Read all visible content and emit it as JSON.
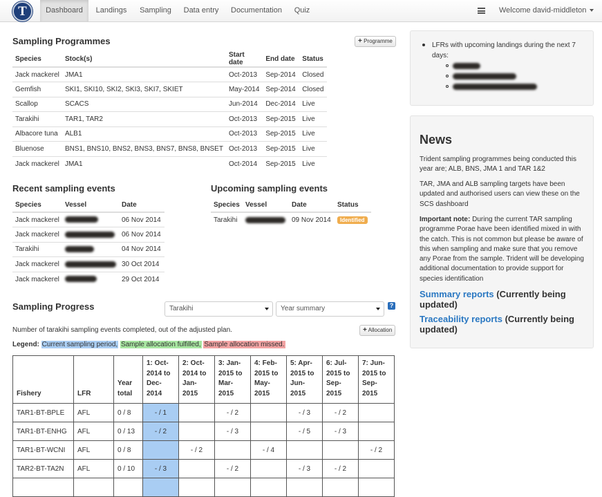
{
  "nav": {
    "logo_letter": "T",
    "items": [
      "Dashboard",
      "Landings",
      "Sampling",
      "Data entry",
      "Documentation",
      "Quiz"
    ],
    "welcome": "Welcome david-middleton"
  },
  "programmes": {
    "title": "Sampling Programmes",
    "button_label": "Programme",
    "headers": [
      "Species",
      "Stock(s)",
      "Start date",
      "End date",
      "Status"
    ],
    "rows": [
      [
        "Jack mackerel",
        "JMA1",
        "Oct-2013",
        "Sep-2014",
        "Closed"
      ],
      [
        "Gemfish",
        "SKI1, SKI10, SKI2, SKI3, SKI7, SKIET",
        "May-2014",
        "Sep-2014",
        "Closed"
      ],
      [
        "Scallop",
        "SCACS",
        "Jun-2014",
        "Dec-2014",
        "Live"
      ],
      [
        "Tarakihi",
        "TAR1, TAR2",
        "Oct-2013",
        "Sep-2015",
        "Live"
      ],
      [
        "Albacore tuna",
        "ALB1",
        "Oct-2013",
        "Sep-2015",
        "Live"
      ],
      [
        "Bluenose",
        "BNS1, BNS10, BNS2, BNS3, BNS7, BNS8, BNSET",
        "Oct-2013",
        "Sep-2015",
        "Live"
      ],
      [
        "Jack mackerel",
        "JMA1",
        "Oct-2014",
        "Sep-2015",
        "Live"
      ]
    ]
  },
  "recent": {
    "title": "Recent sampling events",
    "headers": [
      "Species",
      "Vessel",
      "Date"
    ],
    "rows": [
      [
        "Jack mackerel",
        "06 Nov 2014"
      ],
      [
        "Jack mackerel",
        "06 Nov 2014"
      ],
      [
        "Tarakihi",
        "04 Nov 2014"
      ],
      [
        "Jack mackerel",
        "30 Oct 2014"
      ],
      [
        "Jack mackerel",
        "29 Oct 2014"
      ]
    ]
  },
  "upcoming": {
    "title": "Upcoming sampling events",
    "headers": [
      "Species",
      "Vessel",
      "Date",
      "Status"
    ],
    "rows": [
      [
        "Tarakihi",
        "09 Nov 2014",
        "Identified"
      ]
    ],
    "badge_color": "#f0ad4e"
  },
  "progress": {
    "title": "Sampling Progress",
    "species_select": "Tarakihi",
    "period_select": "Year summary",
    "help": "?",
    "description": "Number of tarakihi sampling events completed, out of the adjusted plan.",
    "button_label": "Allocation",
    "legend_label": "Legend:",
    "legend": [
      {
        "text": "Current sampling period,",
        "color": "#a9cdf3"
      },
      {
        "text": "Sample allocation fulfilled,",
        "color": "#a8e6a1"
      },
      {
        "text": "Sample allocation missed.",
        "color": "#f2a3a3"
      }
    ],
    "headers": [
      "Fishery",
      "LFR",
      "Year total",
      "1: Oct-2014 to Dec-2014",
      "2: Oct-2014 to Jan-2015",
      "3: Jan-2015 to Mar-2015",
      "4: Feb-2015 to May-2015",
      "5: Apr-2015 to Jun-2015",
      "6: Jul-2015 to Sep-2015",
      "7: Jun-2015 to Sep-2015"
    ],
    "rows": [
      [
        "TAR1-BT-BPLE",
        "AFL",
        "0 / 8",
        "- / 1",
        "",
        "- / 2",
        "",
        "- / 3",
        "- / 2",
        ""
      ],
      [
        "TAR1-BT-ENHG",
        "AFL",
        "0 / 13",
        "- / 2",
        "",
        "- / 3",
        "",
        "- / 5",
        "- / 3",
        ""
      ],
      [
        "TAR1-BT-WCNI",
        "AFL",
        "0 / 8",
        "",
        "- / 2",
        "",
        "- / 4",
        "",
        "",
        "- / 2"
      ],
      [
        "TAR2-BT-TA2N",
        "AFL",
        "0 / 10",
        "- / 3",
        "",
        "- / 2",
        "",
        "- / 3",
        "- / 2",
        ""
      ]
    ],
    "current_color": "#a9cdf3"
  },
  "alerts": {
    "heading": "LFRs with upcoming landings during the next 7 days:"
  },
  "news": {
    "title": "News",
    "p1": "Trident sampling programmes being conducted this year are; ALB, BNS, JMA 1 and TAR 1&2",
    "p2": "TAR, JMA and ALB sampling targets have been updated and authorised users can view these on the SCS dashboard",
    "p3_bold": "Important note:",
    "p3": " During the current TAR sampling programme Porae have been identified mixed in with the catch.  This is not common but please be aware of this when sampling and make sure that you remove any Porae from the sample.  Trident will be developing additional documentation to provide support for species identification",
    "link1": "Summary reports",
    "link1_suffix": " (Currently being updated)",
    "link2": "Traceability reports",
    "link2_suffix": " (Currently being updated)"
  }
}
